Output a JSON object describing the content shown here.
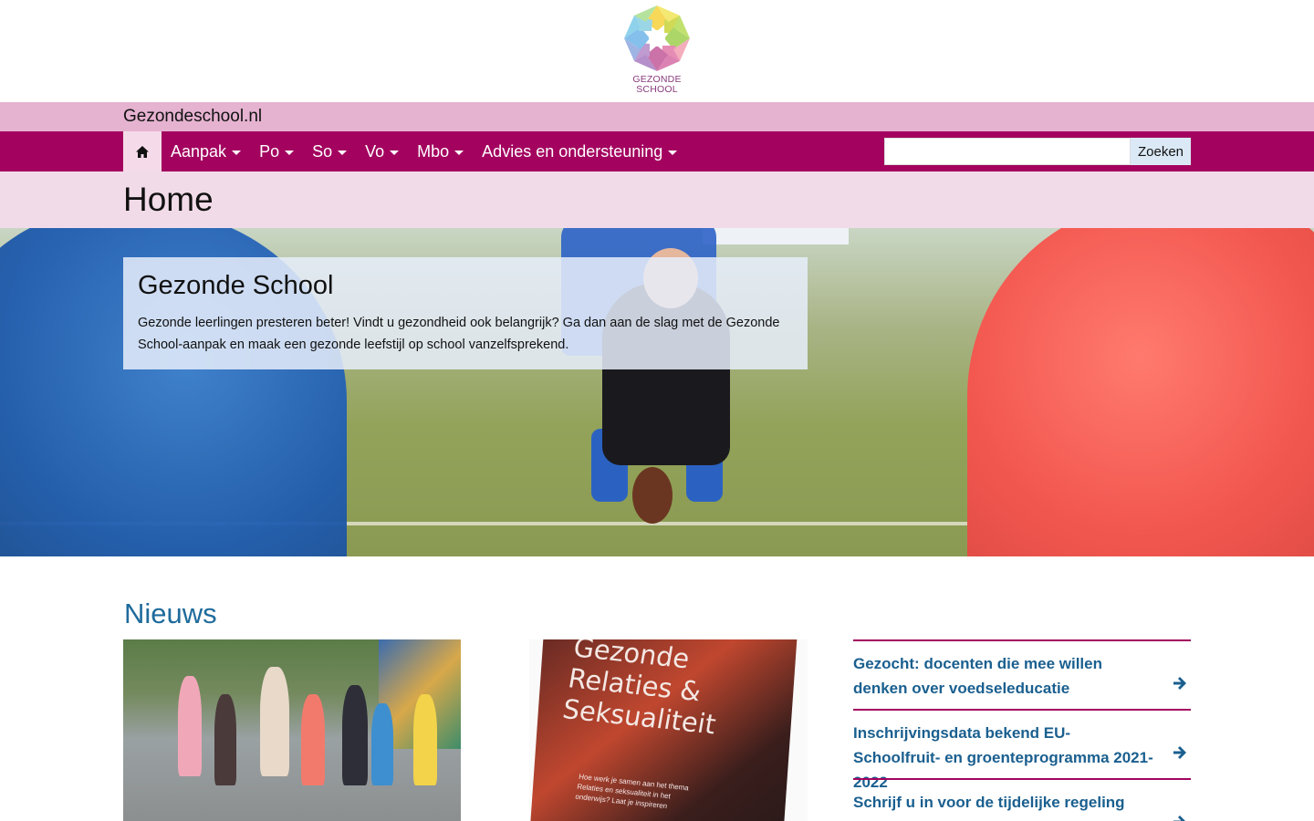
{
  "logo": {
    "text_line1": "GEZONDE",
    "text_line2": "SCHOOL"
  },
  "site_bar": {
    "site_name": "Gezondeschool.nl"
  },
  "nav": {
    "home_icon": "home-icon",
    "items": [
      {
        "label": "Aanpak"
      },
      {
        "label": "Po"
      },
      {
        "label": "So"
      },
      {
        "label": "Vo"
      },
      {
        "label": "Mbo"
      },
      {
        "label": "Advies en ondersteuning"
      }
    ],
    "search": {
      "value": "",
      "button_label": "Zoeken"
    }
  },
  "page": {
    "title": "Home"
  },
  "hero": {
    "card_title": "Gezonde School",
    "card_text": "Gezonde leerlingen presteren beter! Vindt u gezondheid ook belangrijk? Ga dan aan de slag met de Gezonde School-aanpak en maak een gezonde leefstijl op school vanzelfsprekend."
  },
  "news": {
    "title": "Nieuws",
    "brochure_title": "Gezonde Relaties & Seksualiteit",
    "brochure_subtitle": "Hoe werk je samen aan het thema Relaties en seksualiteit in het onderwijs? Laat je inspireren",
    "items": [
      {
        "title": "Gezocht: docenten die mee willen denken over voedseleducatie"
      },
      {
        "title": "Inschrijvingsdata bekend EU-Schoolfruit- en groenteprogramma 2021-2022"
      },
      {
        "title": "Schrijf u in voor de tijdelijke regeling"
      }
    ]
  },
  "colors": {
    "nav_bg": "#a3035f",
    "site_bar_bg": "#e5b2d0",
    "title_bar_bg": "#f2dbe8",
    "link": "#1a5f8f",
    "news_heading": "#1f6b9c"
  }
}
